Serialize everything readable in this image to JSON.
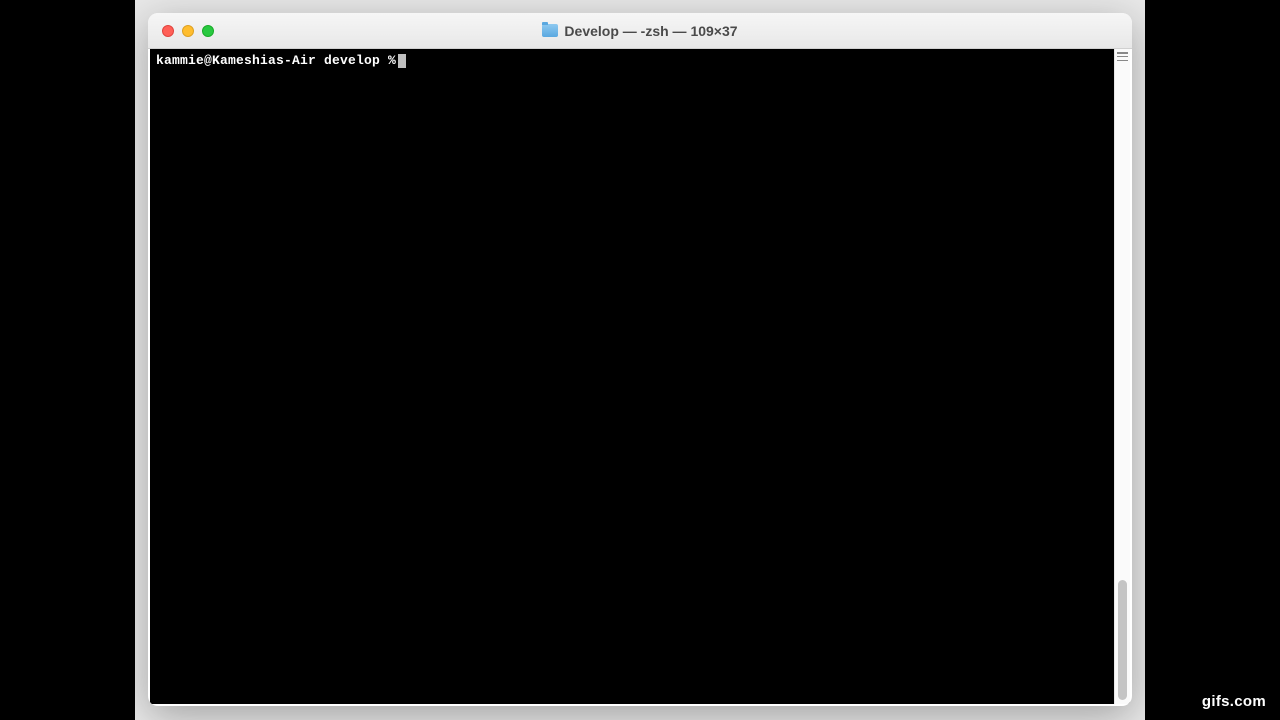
{
  "window": {
    "title": "Develop — -zsh — 109×37",
    "folder_icon": "folder-icon"
  },
  "traffic_lights": {
    "close": "close",
    "minimize": "minimize",
    "maximize": "maximize"
  },
  "terminal": {
    "prompt": "kammie@Kameshias-Air develop %",
    "input": ""
  },
  "watermark": "gifs.com"
}
